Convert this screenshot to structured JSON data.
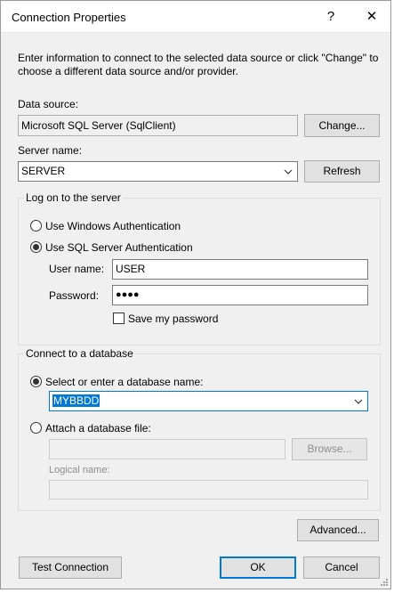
{
  "dialog": {
    "title": "Connection Properties",
    "help_glyph": "?",
    "close_glyph": "✕",
    "intro": "Enter information to connect to the selected data source or click \"Change\" to choose a different data source and/or provider."
  },
  "data_source": {
    "label": "Data source:",
    "value": "Microsoft SQL Server (SqlClient)",
    "change_button": "Change..."
  },
  "server": {
    "label": "Server name:",
    "value": "SERVER",
    "refresh_button": "Refresh"
  },
  "logon": {
    "group_title": "Log on to the server",
    "windows_auth": "Use Windows Authentication",
    "sql_auth": "Use SQL Server Authentication",
    "selected": "sql_auth",
    "user_label": "User name:",
    "user_value": "USER",
    "password_label": "Password:",
    "password_value": "●●●●",
    "save_password": "Save my password",
    "save_password_checked": false
  },
  "database": {
    "group_title": "Connect to a database",
    "select_option": "Select or enter a database name:",
    "select_value": "MYBBDD",
    "attach_option": "Attach a database file:",
    "browse_button": "Browse...",
    "logical_name_label": "Logical name:",
    "selected": "select_option"
  },
  "buttons": {
    "advanced": "Advanced...",
    "test_connection": "Test Connection",
    "ok": "OK",
    "cancel": "Cancel"
  },
  "colors": {
    "accent": "#0078d7",
    "dialog_bg": "#f0f0f0"
  }
}
